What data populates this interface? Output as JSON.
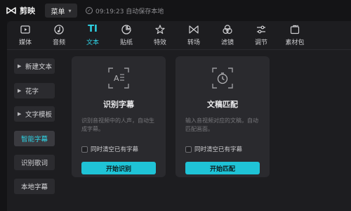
{
  "app": {
    "name": "剪映",
    "menu_label": "菜单",
    "save_status": "09:19:23 自动保存本地"
  },
  "toolbar": [
    {
      "label": "媒体",
      "icon": "media-icon"
    },
    {
      "label": "音频",
      "icon": "audio-icon"
    },
    {
      "label": "文本",
      "icon": "text-icon",
      "glyph": "TI",
      "active": true
    },
    {
      "label": "贴纸",
      "icon": "sticker-icon"
    },
    {
      "label": "特效",
      "icon": "effects-icon"
    },
    {
      "label": "转场",
      "icon": "transition-icon"
    },
    {
      "label": "滤镜",
      "icon": "filter-icon"
    },
    {
      "label": "调节",
      "icon": "adjust-icon"
    },
    {
      "label": "素材包",
      "icon": "material-pack-icon"
    }
  ],
  "sidebar": [
    {
      "label": "新建文本",
      "expandable": true
    },
    {
      "label": "花字",
      "expandable": true
    },
    {
      "label": "文字模板",
      "expandable": true
    },
    {
      "label": "智能字幕",
      "active": true
    },
    {
      "label": "识别歌词"
    },
    {
      "label": "本地字幕"
    }
  ],
  "cards": [
    {
      "title": "识别字幕",
      "icon": "caption-recognition-icon",
      "description": "识别音视频中的人声，自动生成字幕。",
      "checkbox_label": "同时清空已有字幕",
      "button_label": "开始识别"
    },
    {
      "title": "文稿匹配",
      "icon": "script-match-icon",
      "description": "输入音视频对应的文稿，自动匹配画面。",
      "checkbox_label": "同时清空已有字幕",
      "button_label": "开始匹配"
    }
  ],
  "colors": {
    "accent": "#2fd4e6",
    "button": "#1fc3d6",
    "panel": "#1d1d20",
    "card": "#2a2a2e"
  }
}
